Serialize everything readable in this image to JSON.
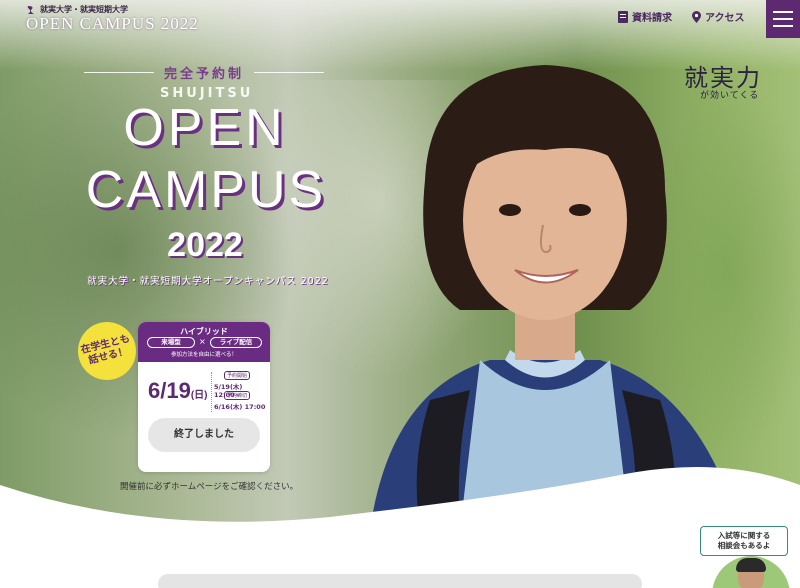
{
  "header": {
    "univ_small": "就実大学・就実短期大学",
    "logo_title": "OPEN CAMPUS 2022",
    "nav_documents": "資料請求",
    "nav_access": "アクセス"
  },
  "hero": {
    "reservation": "完全予約制",
    "shujitsu": "SHUJITSU",
    "title_line1": "OPEN",
    "title_line2": "CAMPUS",
    "year": "2022",
    "subtitle": "就実大学・就実短期大学オープンキャンパス 2022",
    "catch_main": "就実力",
    "catch_sub": "が効いてくる"
  },
  "badge": {
    "line1": "在学生とも",
    "line2": "話せる！"
  },
  "event_card": {
    "format": "ハイブリッド",
    "option1": "来場型",
    "separator": "×",
    "option2": "ライブ配信",
    "note": "参加方法を自由に選べる！",
    "date": "6/19",
    "weekday": "(日)",
    "reserve_start_label": "予約開始",
    "reserve_start_value": "5/19(木) 12:00~",
    "reserve_end_label": "予約締切",
    "reserve_end_value": "6/16(木) 17:00",
    "status_button": "終了しました"
  },
  "notice": "開催前に必ずホームページをご確認ください。",
  "consult": {
    "line1": "入試等に関する",
    "line2": "相談会もあるよ"
  },
  "colors": {
    "brand_purple": "#5d2a72",
    "badge_yellow": "#f4e13b",
    "consult_border": "#3a8a7a"
  }
}
